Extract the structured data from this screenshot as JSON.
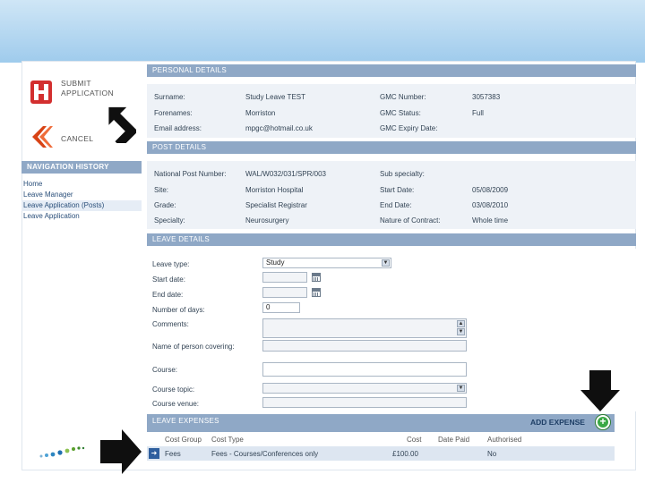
{
  "sidebar": {
    "submit_label": "SUBMIT APPLICATION",
    "cancel_label": "CANCEL",
    "nav_history_title": "NAVIGATION HISTORY",
    "nav_items": [
      "Home",
      "Leave Manager",
      "Leave Application (Posts)",
      "Leave Application"
    ]
  },
  "personal": {
    "title": "PERSONAL DETAILS",
    "fields": [
      {
        "label": "Surname:",
        "value": "Study Leave TEST"
      },
      {
        "label": "Forenames:",
        "value": "Morriston"
      },
      {
        "label": "Email address:",
        "value": "mpgc@hotmail.co.uk"
      },
      {
        "label": "GMC Number:",
        "value": "3057383"
      },
      {
        "label": "GMC Status:",
        "value": "Full"
      },
      {
        "label": "GMC Expiry Date:",
        "value": ""
      }
    ]
  },
  "post": {
    "title": "POST DETAILS",
    "fields": [
      {
        "label": "National Post Number:",
        "value": "WAL/W032/031/SPR/003"
      },
      {
        "label": "Site:",
        "value": "Morriston Hospital"
      },
      {
        "label": "Grade:",
        "value": "Specialist Registrar"
      },
      {
        "label": "Specialty:",
        "value": "Neurosurgery"
      },
      {
        "label": "Sub specialty:",
        "value": ""
      },
      {
        "label": "Start Date:",
        "value": "05/08/2009"
      },
      {
        "label": "End Date:",
        "value": "03/08/2010"
      },
      {
        "label": "Nature of Contract:",
        "value": "Whole time"
      }
    ]
  },
  "leave": {
    "title": "LEAVE DETAILS",
    "labels": {
      "leave_type": "Leave type:",
      "start_date": "Start date:",
      "end_date": "End date:",
      "num_days": "Number of days:",
      "comments": "Comments:",
      "person_covering": "Name of person covering:",
      "course": "Course:",
      "course_topic": "Course topic:",
      "course_venue": "Course venue:"
    },
    "leave_type_value": "Study",
    "num_days_value": "0"
  },
  "expenses": {
    "title": "LEAVE EXPENSES",
    "add_label": "ADD EXPENSE",
    "columns": [
      "Cost Group",
      "Cost Type",
      "Cost",
      "Date Paid",
      "Authorised"
    ],
    "rows": [
      {
        "group": "Fees",
        "type": "Fees - Courses/Conferences only",
        "cost": "£100.00",
        "date_paid": "",
        "authorised": "No"
      }
    ]
  }
}
